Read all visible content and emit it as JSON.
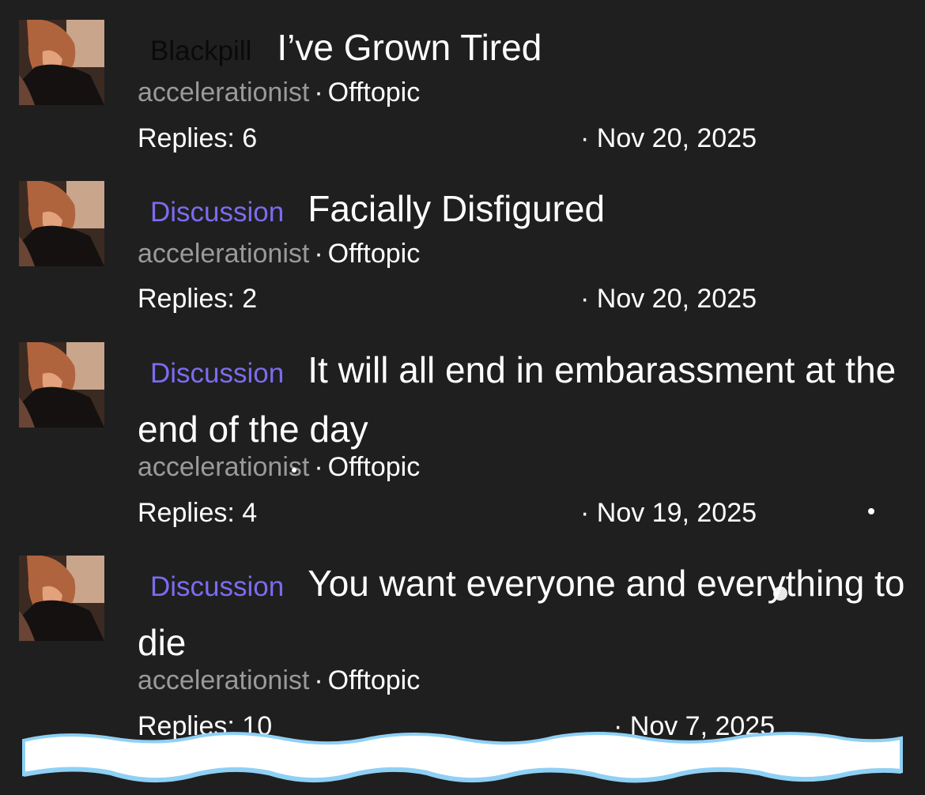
{
  "threads": [
    {
      "prefix": "Blackpill",
      "title": "I’ve Grown Tired",
      "author": "accelerationist",
      "separator": "·",
      "forum": "Offtopic",
      "replies": "Replies: 6",
      "date": "· Nov 20, 2025"
    },
    {
      "prefix": "Discussion",
      "title": "Facially Disfigured",
      "author": "accelerationist",
      "separator": "·",
      "forum": "Offtopic",
      "replies": "Replies: 2",
      "date": "· Nov 20, 2025"
    },
    {
      "prefix": "Discussion",
      "title": "It will all end in embarassment at the end of the day",
      "author": "accelerationist",
      "separator": "·",
      "forum": "Offtopic",
      "replies": "Replies: 4",
      "date": "· Nov 19, 2025"
    },
    {
      "prefix": "Discussion",
      "title": "You want everyone and everything to die",
      "author": "accelerationist",
      "separator": "·",
      "forum": "Offtopic",
      "replies": "Replies: 10",
      "date": "· Nov 7, 2025"
    }
  ],
  "colors": {
    "background": "#1f1f1f",
    "discussion_prefix": "#7b6cf0",
    "author": "#9a9a9a",
    "text": "#ffffff",
    "wave_fill": "#ffffff",
    "wave_stroke": "#8fd0f5"
  },
  "icons": {
    "avatar": "user-avatar-icon"
  }
}
